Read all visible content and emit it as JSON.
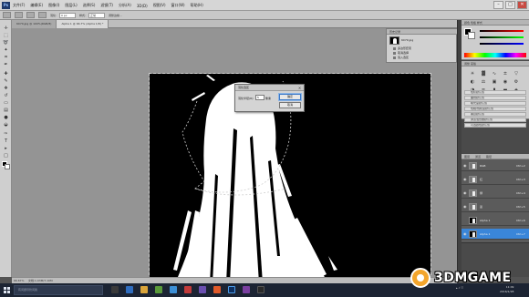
{
  "app": {
    "logo": "Ps",
    "menu": [
      "文件(F)",
      "编辑(E)",
      "图像(I)",
      "图层(L)",
      "选择(S)",
      "滤镜(T)",
      "分析(A)",
      "3D(D)",
      "视图(V)",
      "窗口(W)",
      "帮助(H)"
    ],
    "window_buttons": [
      "–",
      "□",
      "✕"
    ]
  },
  "options": {
    "feather_label": "羽化:",
    "feather_value": "0 px",
    "style_label": "样式:",
    "style_value": "正常",
    "refine_label": "调整边缘..."
  },
  "document_tabs": [
    {
      "label": "6079.jpg @ 100%(RGB/8)",
      "active": false
    },
    {
      "label": "Alpha 1 @ 66.7% (Alpha 1/8) *",
      "active": true
    }
  ],
  "status": {
    "zoom": "66.67%",
    "doc": "文档:1.03M/7.10M"
  },
  "dialog": {
    "title": "羽化选区",
    "feather_label": "羽化半径(R):",
    "feather_value": "5",
    "unit": "像素",
    "ok": "确定",
    "cancel": "取消"
  },
  "history": {
    "tab": "历史记录",
    "doc_name": "6079.jpg",
    "rows": [
      "多边形套索",
      "取消选择",
      "载入选区",
      "反向",
      "羽化"
    ]
  },
  "color_panel": {
    "tabs": "颜色  色板  样式",
    "fg": "#000000",
    "bg": "#ffffff"
  },
  "adjustments": {
    "tab": "调整  蒙版",
    "icons": [
      "brightness-icon",
      "levels-icon",
      "curves-icon",
      "exposure-icon",
      "vibrance-icon",
      "hue-icon",
      "balance-icon",
      "bw-icon",
      "photo-filter-icon",
      "mixer-icon",
      "invert-icon",
      "posterize-icon",
      "threshold-icon",
      "gradient-map-icon",
      "selective-color-icon"
    ],
    "icon_glyphs": [
      "☀",
      "▓",
      "∿",
      "±",
      "▽",
      "◐",
      "⚖",
      "▣",
      "◉",
      "⚙",
      "◑",
      "≡",
      "▮",
      "▬",
      "◈"
    ],
    "presets": [
      "色阶默认值",
      "曲线默认值",
      "曝光度默认值",
      "色相/饱和度默认值",
      "黑白默认值",
      "通道混合器默认值",
      "可选颜色默认值"
    ]
  },
  "channels": {
    "tabs": [
      "图层",
      "通道",
      "路径"
    ],
    "rows": [
      {
        "name": "RGB",
        "key": "Ctrl+2",
        "thumb": "gray",
        "visible": true,
        "active": false
      },
      {
        "name": "红",
        "key": "Ctrl+3",
        "thumb": "gray",
        "visible": true,
        "active": false
      },
      {
        "name": "绿",
        "key": "Ctrl+4",
        "thumb": "gray",
        "visible": true,
        "active": false
      },
      {
        "name": "蓝",
        "key": "Ctrl+5",
        "thumb": "gray",
        "visible": true,
        "active": false
      },
      {
        "name": "Alpha 1",
        "key": "Ctrl+6",
        "thumb": "black",
        "visible": false,
        "active": false
      },
      {
        "name": "Alpha 1",
        "key": "Ctrl+7",
        "thumb": "black",
        "visible": true,
        "active": true
      }
    ]
  },
  "taskbar": {
    "search_placeholder": "有问题尽管问我",
    "clock_time": "11:09",
    "clock_date": "2016/1/28"
  },
  "watermark": {
    "text": "3DMGAME"
  }
}
